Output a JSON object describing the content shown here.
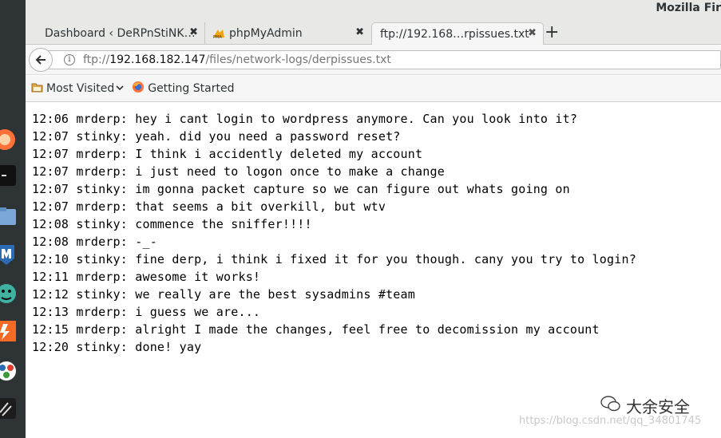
{
  "window": {
    "title": "Mozilla Fir"
  },
  "tabs": [
    {
      "label": "Dashboard ‹ DeRPnStiNK…",
      "close": "✖"
    },
    {
      "label": "phpMyAdmin",
      "close": "✖"
    },
    {
      "label": "ftp://192.168…rpissues.txt",
      "close": "✖"
    }
  ],
  "new_tab_label": "+",
  "urlbar": {
    "scheme": "ftp://",
    "host": "192.168.182.147",
    "path": "/files/network-logs/derpissues.txt"
  },
  "bookmarks": [
    {
      "label": "Most Visited",
      "icon": "folder-icon",
      "dropdown": "⌄"
    },
    {
      "label": "Getting Started",
      "icon": "firefox-icon"
    }
  ],
  "log_lines": [
    "12:06 mrderp: hey i cant login to wordpress anymore. Can you look into it?",
    "12:07 stinky: yeah. did you need a password reset?",
    "12:07 mrderp: I think i accidently deleted my account",
    "12:07 mrderp: i just need to logon once to make a change",
    "12:07 stinky: im gonna packet capture so we can figure out whats going on",
    "12:07 mrderp: that seems a bit overkill, but wtv",
    "12:08 stinky: commence the sniffer!!!!",
    "12:08 mrderp: -_-",
    "12:10 stinky: fine derp, i think i fixed it for you though. cany you try to login?",
    "12:11 mrderp: awesome it works!",
    "12:12 stinky: we really are the best sysadmins #team",
    "12:13 mrderp: i guess we are...",
    "12:15 mrderp: alright I made the changes, feel free to decomission my account",
    "12:20 stinky: done! yay"
  ],
  "watermark": {
    "brand": "大余安全",
    "url": "https://blog.csdn.net/qq_34801745"
  },
  "colors": {
    "dock": "#2e3436",
    "chrome": "#e8e8e7",
    "toolbar": "#f6f6f6"
  }
}
